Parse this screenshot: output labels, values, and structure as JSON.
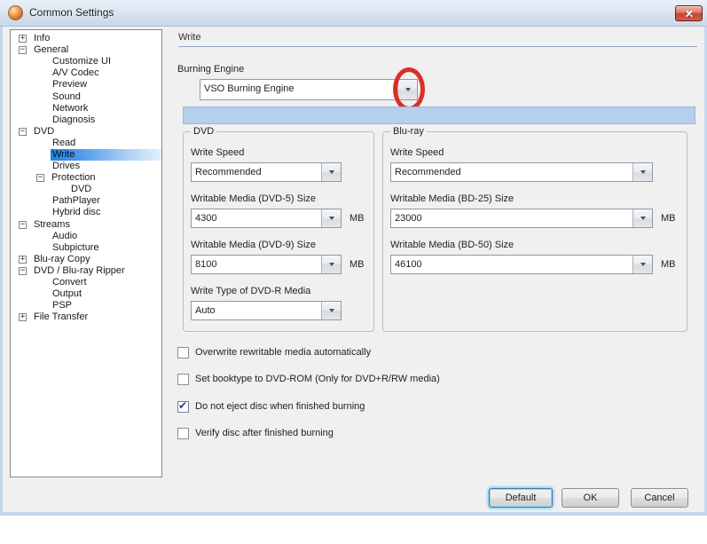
{
  "window": {
    "title": "Common Settings"
  },
  "icons": {
    "app": "dvdfab-logo",
    "close": "x",
    "dropdown_arrow": "triangle-down",
    "expander_collapsed": "+",
    "expander_expanded": "−",
    "checkmark": "✔"
  },
  "colors": {
    "annotation": "#d93025",
    "highlight_bar": "#b5cfec",
    "selection_blue": "#1f80e2",
    "close_red": "#c44434"
  },
  "tree": {
    "items": [
      {
        "label": "Info",
        "level": 0,
        "expander": "collapsed",
        "selected": false
      },
      {
        "label": "General",
        "level": 0,
        "expander": "expanded",
        "selected": false
      },
      {
        "label": "Customize UI",
        "level": 1,
        "expander": null,
        "selected": false
      },
      {
        "label": "A/V Codec",
        "level": 1,
        "expander": null,
        "selected": false
      },
      {
        "label": "Preview",
        "level": 1,
        "expander": null,
        "selected": false
      },
      {
        "label": "Sound",
        "level": 1,
        "expander": null,
        "selected": false
      },
      {
        "label": "Network",
        "level": 1,
        "expander": null,
        "selected": false
      },
      {
        "label": "Diagnosis",
        "level": 1,
        "expander": null,
        "selected": false
      },
      {
        "label": "DVD",
        "level": 0,
        "expander": "expanded",
        "selected": false
      },
      {
        "label": "Read",
        "level": 1,
        "expander": null,
        "selected": false
      },
      {
        "label": "Write",
        "level": 1,
        "expander": null,
        "selected": true
      },
      {
        "label": "Drives",
        "level": 1,
        "expander": null,
        "selected": false
      },
      {
        "label": "Protection",
        "level": 1,
        "expander": "expanded",
        "selected": false
      },
      {
        "label": "DVD",
        "level": 2,
        "expander": null,
        "selected": false
      },
      {
        "label": "PathPlayer",
        "level": 1,
        "expander": null,
        "selected": false
      },
      {
        "label": "Hybrid disc",
        "level": 1,
        "expander": null,
        "selected": false
      },
      {
        "label": "Streams",
        "level": 0,
        "expander": "expanded",
        "selected": false
      },
      {
        "label": "Audio",
        "level": 1,
        "expander": null,
        "selected": false
      },
      {
        "label": "Subpicture",
        "level": 1,
        "expander": null,
        "selected": false
      },
      {
        "label": "Blu-ray Copy",
        "level": 0,
        "expander": "collapsed",
        "selected": false
      },
      {
        "label": "DVD / Blu-ray Ripper",
        "level": 0,
        "expander": "expanded",
        "selected": false
      },
      {
        "label": "Convert",
        "level": 1,
        "expander": null,
        "selected": false
      },
      {
        "label": "Output",
        "level": 1,
        "expander": null,
        "selected": false
      },
      {
        "label": "PSP",
        "level": 1,
        "expander": null,
        "selected": false
      },
      {
        "label": "File Transfer",
        "level": 0,
        "expander": "collapsed",
        "selected": false
      }
    ]
  },
  "content": {
    "header": "Write",
    "burning_engine": {
      "label": "Burning Engine",
      "value": "VSO Burning Engine"
    },
    "groups": [
      {
        "title": "DVD",
        "fields": [
          {
            "label": "Write Speed",
            "value": "Recommended",
            "suffix": ""
          },
          {
            "label": "Writable Media (DVD-5) Size",
            "value": "4300",
            "suffix": "MB"
          },
          {
            "label": "Writable Media (DVD-9) Size",
            "value": "8100",
            "suffix": "MB"
          },
          {
            "label": "Write Type of DVD-R Media",
            "value": "Auto",
            "suffix": ""
          }
        ]
      },
      {
        "title": "Blu-ray",
        "fields": [
          {
            "label": "Write Speed",
            "value": "Recommended",
            "suffix": ""
          },
          {
            "label": "Writable Media (BD-25) Size",
            "value": "23000",
            "suffix": "MB"
          },
          {
            "label": "Writable Media (BD-50) Size",
            "value": "46100",
            "suffix": "MB"
          }
        ]
      }
    ],
    "checkboxes": [
      {
        "label": "Overwrite rewritable media automatically",
        "checked": false
      },
      {
        "label": "Set booktype to DVD-ROM (Only for DVD+R/RW media)",
        "checked": false
      },
      {
        "label": "Do not eject disc when finished burning",
        "checked": true
      },
      {
        "label": "Verify disc after finished burning",
        "checked": false
      }
    ]
  },
  "footer": {
    "buttons": [
      {
        "label": "Default",
        "focused": true
      },
      {
        "label": "OK",
        "focused": false
      },
      {
        "label": "Cancel",
        "focused": false
      }
    ]
  }
}
